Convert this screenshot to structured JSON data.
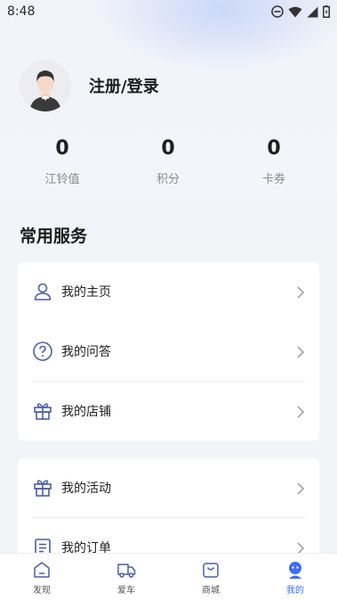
{
  "status_bar": {
    "time": "8:48"
  },
  "profile": {
    "login_label": "注册/登录"
  },
  "stats": [
    {
      "value": "0",
      "label": "江铃值"
    },
    {
      "value": "0",
      "label": "积分"
    },
    {
      "value": "0",
      "label": "卡券"
    }
  ],
  "services": {
    "title": "常用服务",
    "card1": [
      {
        "label": "我的主页",
        "icon": "user-icon"
      },
      {
        "label": "我的问答",
        "icon": "question-icon"
      },
      {
        "label": "我的店铺",
        "icon": "gift-icon"
      }
    ],
    "card2": [
      {
        "label": "我的活动",
        "icon": "gift-icon"
      },
      {
        "label": "我的订单",
        "icon": "order-icon"
      }
    ]
  },
  "tabbar": {
    "items": [
      {
        "label": "发现",
        "icon": "home-icon",
        "active": false
      },
      {
        "label": "爱车",
        "icon": "truck-icon",
        "active": false
      },
      {
        "label": "商城",
        "icon": "bag-icon",
        "active": false
      },
      {
        "label": "我的",
        "icon": "person-icon",
        "active": true
      }
    ]
  },
  "colors": {
    "accent": "#3e6df3",
    "icon": "#4a5ea8",
    "background": "#f2f4f8",
    "card": "#ffffff"
  }
}
